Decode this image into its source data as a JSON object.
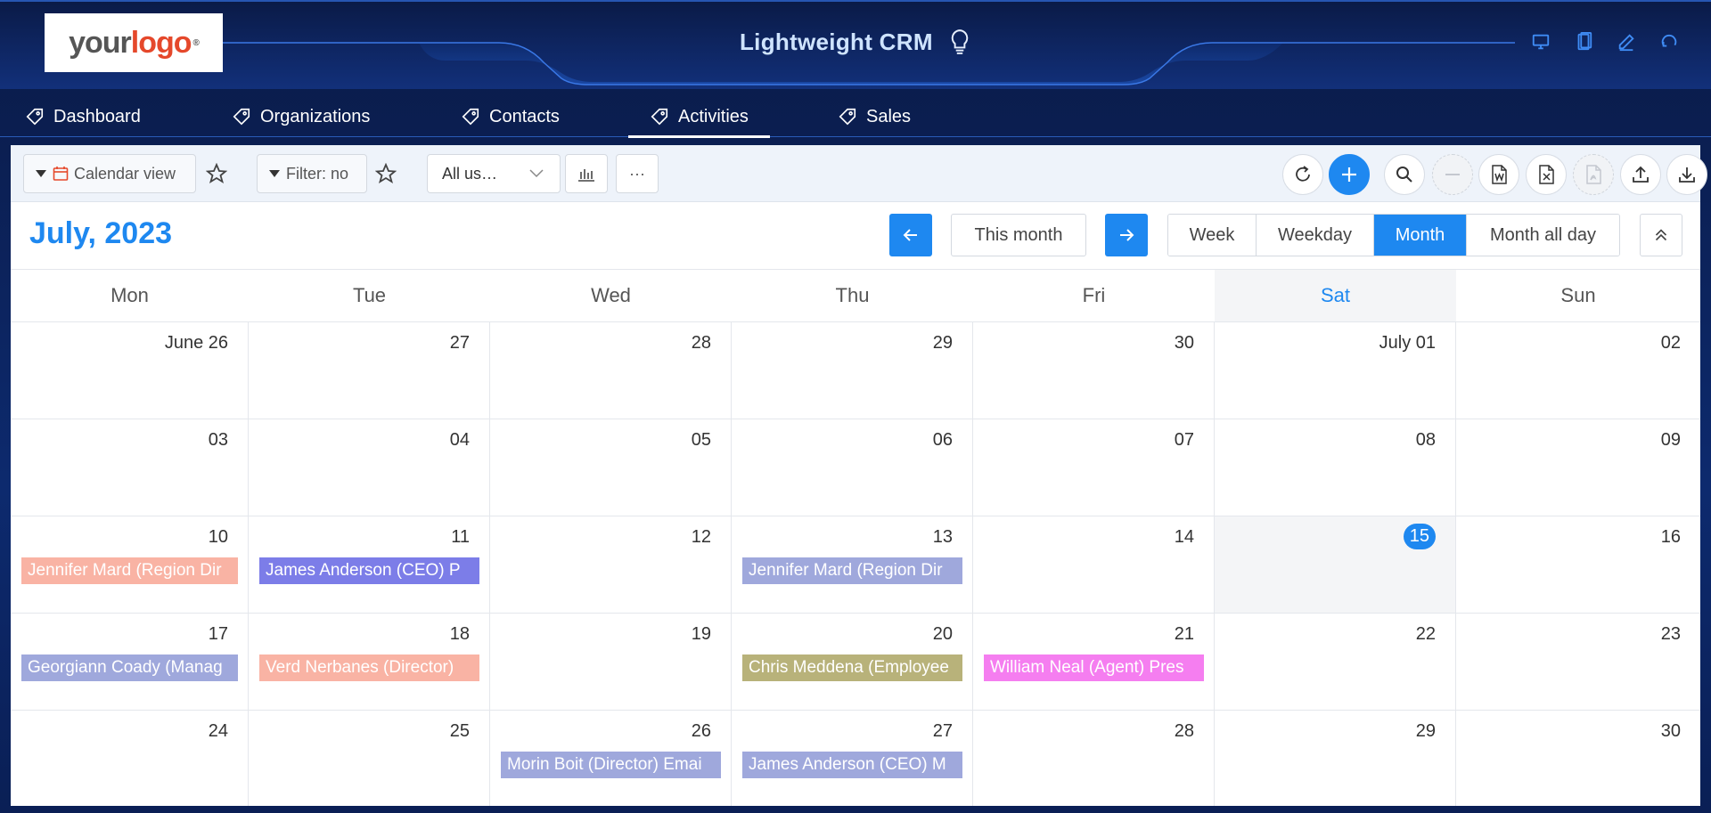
{
  "header": {
    "logo_your": "your",
    "logo_logo": "logo",
    "logo_reg": "®",
    "title": "Lightweight CRM",
    "icons": [
      "desktop-icon",
      "tablet-icon",
      "edit-icon",
      "refresh-icon"
    ]
  },
  "nav": {
    "items": [
      {
        "label": "Dashboard"
      },
      {
        "label": "Organizations"
      },
      {
        "label": "Contacts"
      },
      {
        "label": "Activities",
        "active": true
      },
      {
        "label": "Sales"
      }
    ]
  },
  "toolbar": {
    "view_label": "Calendar view",
    "filter_label": "Filter: no",
    "users_select": "All us…",
    "more_label": "···"
  },
  "calendar": {
    "month_title": "July, 2023",
    "this_month": "This month",
    "views": [
      "Week",
      "Weekday",
      "Month",
      "Month all day"
    ],
    "active_view": "Month",
    "weekdays": [
      "Mon",
      "Tue",
      "Wed",
      "Thu",
      "Fri",
      "Sat",
      "Sun"
    ],
    "weeks": [
      [
        {
          "num": "June 26"
        },
        {
          "num": "27"
        },
        {
          "num": "28"
        },
        {
          "num": "29"
        },
        {
          "num": "30"
        },
        {
          "num": "July 01"
        },
        {
          "num": "02"
        }
      ],
      [
        {
          "num": "03"
        },
        {
          "num": "04"
        },
        {
          "num": "05"
        },
        {
          "num": "06"
        },
        {
          "num": "07"
        },
        {
          "num": "08"
        },
        {
          "num": "09"
        }
      ],
      [
        {
          "num": "10",
          "event": "Jennifer Mard (Region Dir",
          "color": "#f9b3a4"
        },
        {
          "num": "11",
          "event": "James Anderson (CEO) P",
          "color": "#7c7de8"
        },
        {
          "num": "12"
        },
        {
          "num": "13",
          "event": "Jennifer Mard (Region Dir",
          "color": "#9fa8dc"
        },
        {
          "num": "14"
        },
        {
          "num": "15",
          "today": true,
          "shade": true
        },
        {
          "num": "16"
        }
      ],
      [
        {
          "num": "17",
          "event": "Georgiann Coady (Manag",
          "color": "#9fa8dc"
        },
        {
          "num": "18",
          "event": "Verd Nerbanes (Director)",
          "color": "#f9b3a4"
        },
        {
          "num": "19"
        },
        {
          "num": "20",
          "event": "Chris Meddena (Employee",
          "color": "#b8b27a"
        },
        {
          "num": "21",
          "event": "William Neal (Agent) Pres",
          "color": "#f57ef0"
        },
        {
          "num": "22"
        },
        {
          "num": "23"
        }
      ],
      [
        {
          "num": "24"
        },
        {
          "num": "25"
        },
        {
          "num": "26",
          "event": "Morin Boit (Director) Emai",
          "color": "#9fa8dc"
        },
        {
          "num": "27",
          "event": "James Anderson (CEO) M",
          "color": "#9fa8dc"
        },
        {
          "num": "28"
        },
        {
          "num": "29"
        },
        {
          "num": "30"
        }
      ]
    ]
  }
}
